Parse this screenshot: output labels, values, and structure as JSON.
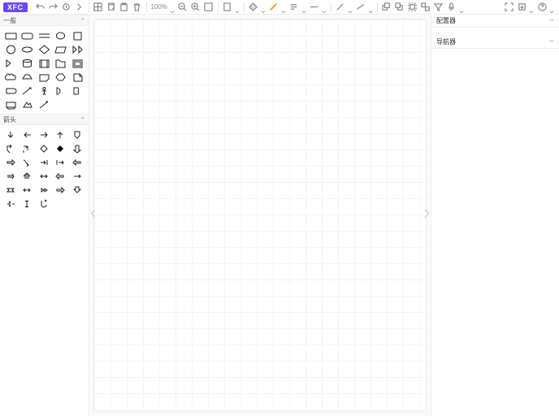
{
  "brand": "XFC",
  "zoom": "100%",
  "toolbar_icons": [
    "undo",
    "redo",
    "divider",
    "delete",
    "copy",
    "cut",
    "paste",
    "trash",
    "divider",
    "zoom",
    "zoom-out",
    "zoom-in",
    "fit",
    "divider",
    "grid",
    "layers",
    "divider",
    "fill",
    "stroke",
    "align",
    "line",
    "divider",
    "connector",
    "arrow",
    "divider",
    "tofront",
    "toback",
    "group",
    "ungroup",
    "filter",
    "mic"
  ],
  "toolbar_right_icons": [
    "fullscreen",
    "export",
    "help"
  ],
  "sidebar": {
    "sections": [
      {
        "title": "一般",
        "count": 30
      },
      {
        "title": "箭头",
        "count": 30
      }
    ]
  },
  "right_panels": [
    {
      "title": "配置器"
    },
    {
      "title": "导航器"
    }
  ]
}
